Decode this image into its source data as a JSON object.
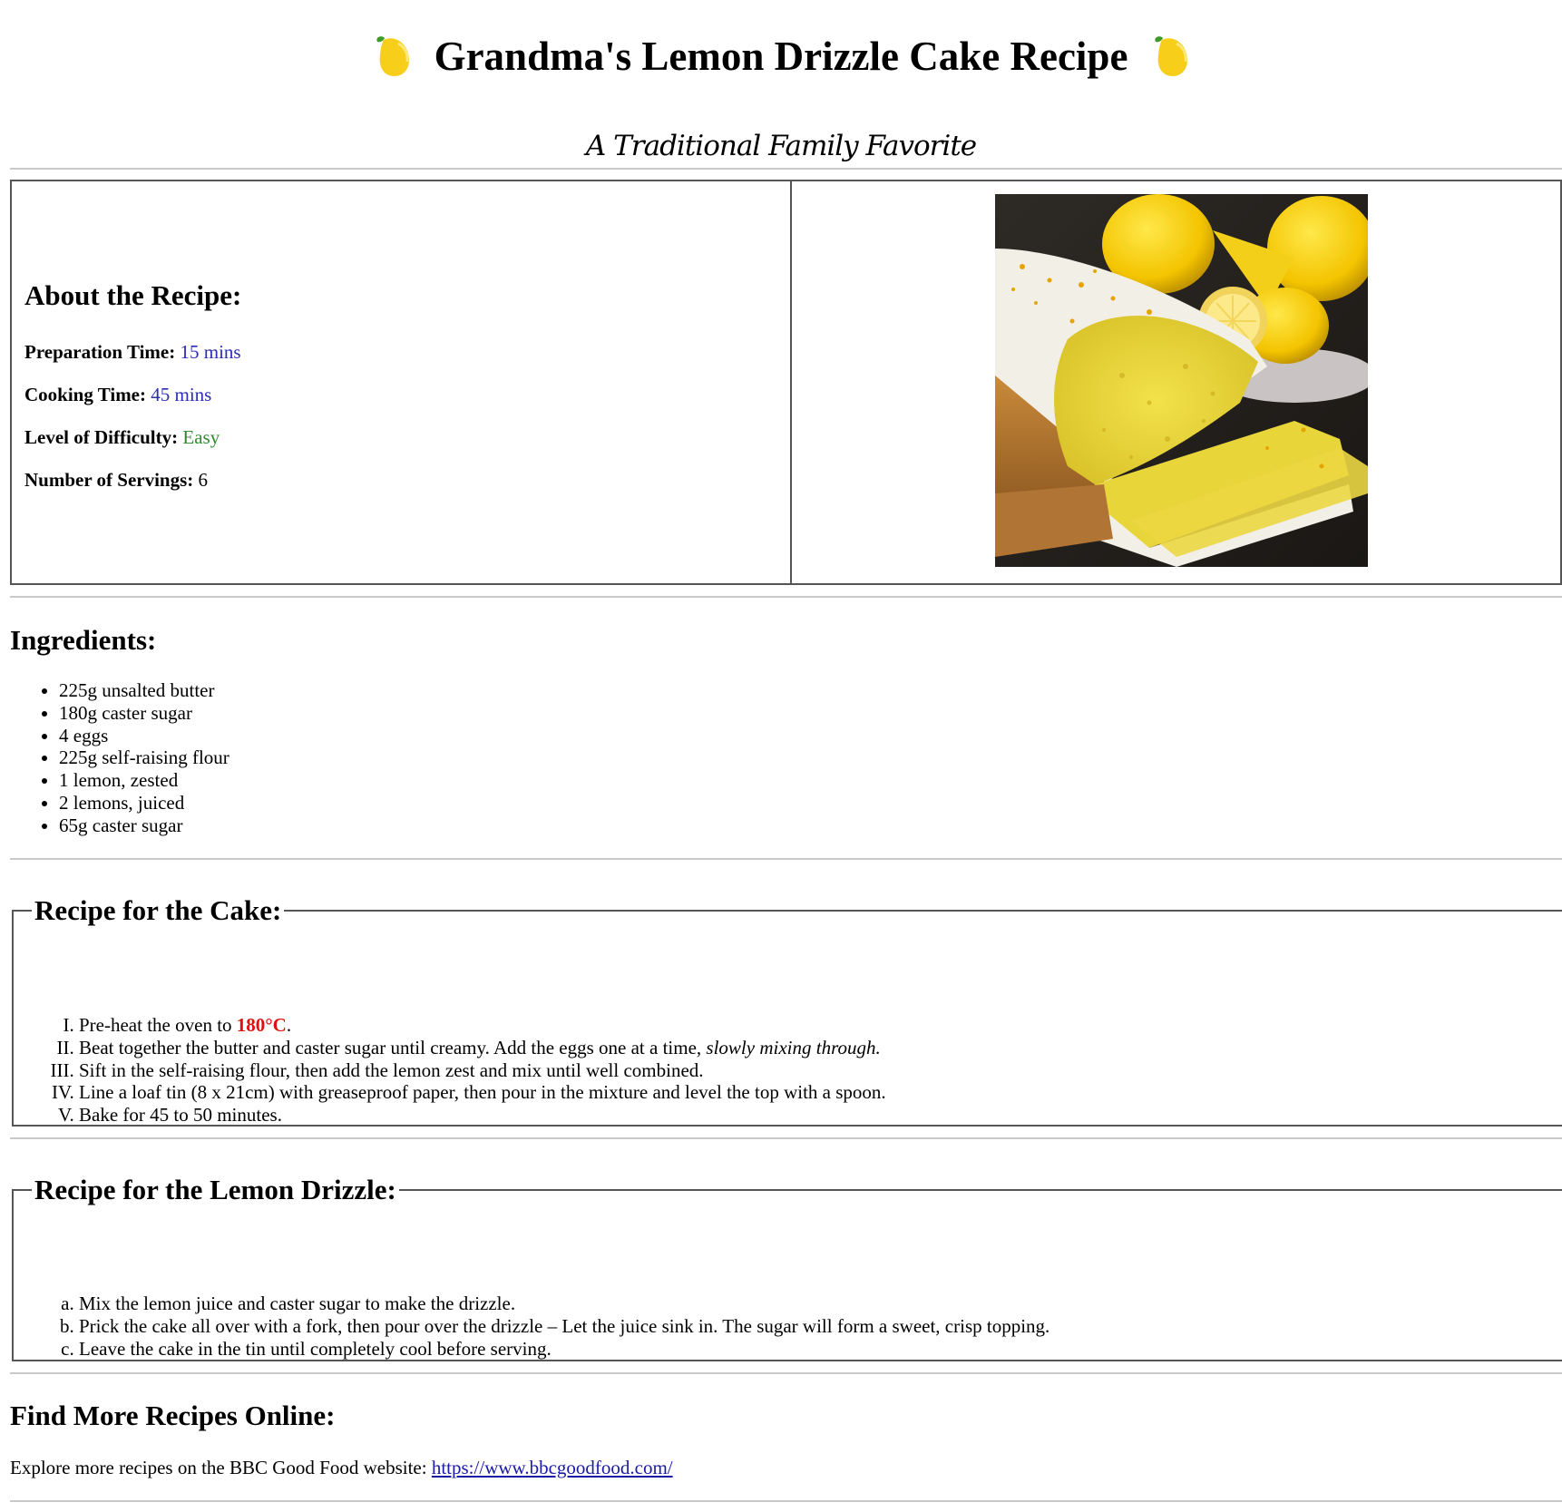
{
  "header": {
    "title": "Grandma's Lemon Drizzle Cake Recipe",
    "subtitle": "A Traditional Family Favorite",
    "icon": "lemon-icon"
  },
  "about": {
    "heading": "About the Recipe:",
    "prep_label": "Preparation Time:",
    "prep_value": "15 mins",
    "cook_label": "Cooking Time:",
    "cook_value": "45 mins",
    "difficulty_label": "Level of Difficulty:",
    "difficulty_value": "Easy",
    "servings_label": "Number of Servings:",
    "servings_value": "6",
    "image_alt": "Lemon drizzle cake"
  },
  "ingredients": {
    "heading": "Ingredients:",
    "items": [
      "225g unsalted butter",
      "180g caster sugar",
      "4 eggs",
      "225g self-raising flour",
      "1 lemon, zested",
      "2 lemons, juiced",
      "65g caster sugar"
    ]
  },
  "cake": {
    "legend": "Recipe for the Cake:",
    "step1_pre": "Pre-heat the oven to ",
    "step1_temp": "180°C",
    "step1_post": ".",
    "step2_pre": "Beat together the butter and caster sugar until creamy. Add the eggs one at a time, ",
    "step2_em": "slowly mixing through.",
    "step3": "Sift in the self-raising flour, then add the lemon zest and mix until well combined.",
    "step4": "Line a loaf tin (8 x 21cm) with greaseproof paper, then pour in the mixture and level the top with a spoon.",
    "step5": "Bake for 45 to 50 minutes."
  },
  "drizzle": {
    "legend": "Recipe for the Lemon Drizzle:",
    "steps": [
      "Mix the lemon juice and caster sugar to make the drizzle.",
      "Prick the cake all over with a fork, then pour over the drizzle – Let the juice sink in. The sugar will form a sweet, crisp topping.",
      "Leave the cake in the tin until completely cool before serving."
    ]
  },
  "footer": {
    "heading": "Find More Recipes Online:",
    "text": "Explore more recipes on the BBC Good Food website: ",
    "link": "https://www.bbcgoodfood.com/"
  },
  "colors": {
    "blue_value": "#2b2bb5",
    "green_value": "#2f8a2f",
    "temperature": "#e01010",
    "link": "#1a1aa6"
  }
}
